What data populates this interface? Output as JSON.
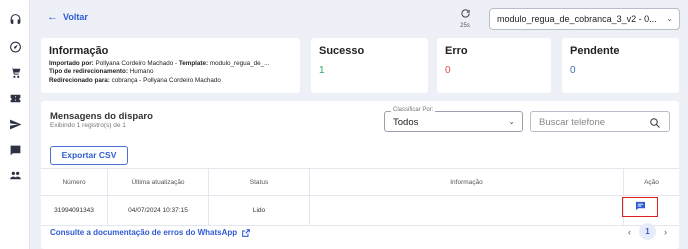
{
  "topbar": {
    "back_label": "Voltar",
    "timer_label": "25s",
    "template_select_value": "modulo_regua_de_cobranca_3_v2 - 0..."
  },
  "cards": {
    "info": {
      "title": "Informação",
      "imported_by_label": "Importado por:",
      "imported_by_value": "Pollyana Cordeiro Machado",
      "template_label": "Template:",
      "template_value": "modulo_regua_de_...",
      "redirect_type_label": "Tipo de redirecionamento:",
      "redirect_type_value": "Humano",
      "redirected_to_label": "Redirecionado para:",
      "redirected_to_value": "cobrança - Pollyana Cordeiro Machado"
    },
    "success": {
      "title": "Sucesso",
      "value": "1",
      "color": "#27ae60"
    },
    "error": {
      "title": "Erro",
      "value": "0",
      "color": "#e0533a"
    },
    "pending": {
      "title": "Pendente",
      "value": "0",
      "color": "#3f6fa8"
    }
  },
  "messages": {
    "title": "Mensagens do disparo",
    "subtitle": "Exibindo 1 registro(s) de 1",
    "sort": {
      "label": "Classificar Por:",
      "value": "Todos"
    },
    "search": {
      "placeholder": "Buscar telefone"
    },
    "export_label": "Exportar CSV",
    "columns": [
      "Número",
      "Última atualização",
      "Status",
      "Informação",
      "Ação"
    ],
    "rows": [
      {
        "numero": "31994091343",
        "atualizacao": "04/07/2024 10:37:15",
        "status": "Lido",
        "informacao": "",
        "acao_icon": "chat-icon"
      }
    ],
    "docs_link": "Consulte a documentação de erros do WhatsApp",
    "pagination": {
      "current_page": "1"
    }
  },
  "sidebar": {
    "icons": [
      "support-icon",
      "dashboard-icon",
      "cart-icon",
      "campaign-icon",
      "send-icon",
      "chat-icon",
      "users-icon"
    ]
  },
  "colors": {
    "accent": "#2f5bd3",
    "highlight_border": "#e02020"
  }
}
